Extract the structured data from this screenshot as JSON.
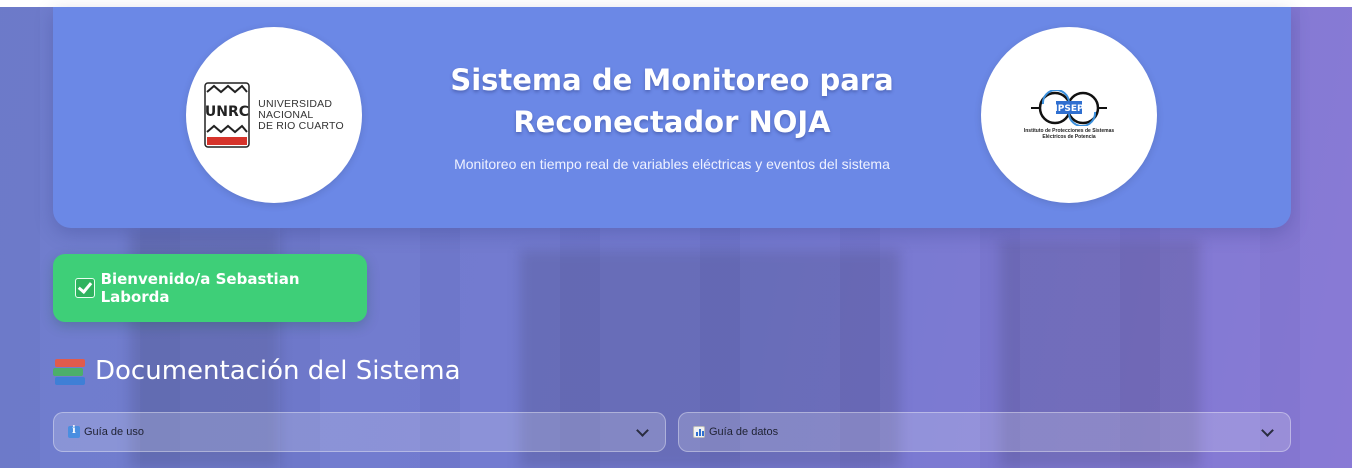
{
  "header": {
    "title_line1": "Sistema de Monitoreo para",
    "title_line2": "Reconectador NOJA",
    "subtitle": "Monitoreo en tiempo real de variables eléctricas y eventos del sistema",
    "left_logo": {
      "badge_text": "UNRC",
      "line1": "UNIVERSIDAD",
      "line2": "NACIONAL",
      "line3": "DE RIO CUARTO"
    },
    "right_logo": {
      "name": "IPSEP",
      "caption_line1": "Instituto de Protecciones de Sistemas",
      "caption_line2": "Eléctricos de Potencia"
    }
  },
  "welcome": {
    "text": "Bienvenido/a Sebastian Laborda",
    "icon": "check-mark-icon"
  },
  "documentation": {
    "title": "Documentación del Sistema",
    "icon": "books-icon",
    "expanders": [
      {
        "label": "Guía de uso",
        "icon": "info-icon"
      },
      {
        "label": "Guía de datos",
        "icon": "bar-chart-icon"
      }
    ]
  },
  "colors": {
    "header_bg": "#6b88e6",
    "welcome_bg": "#3ecf78",
    "page_tint": "#7378c8"
  }
}
